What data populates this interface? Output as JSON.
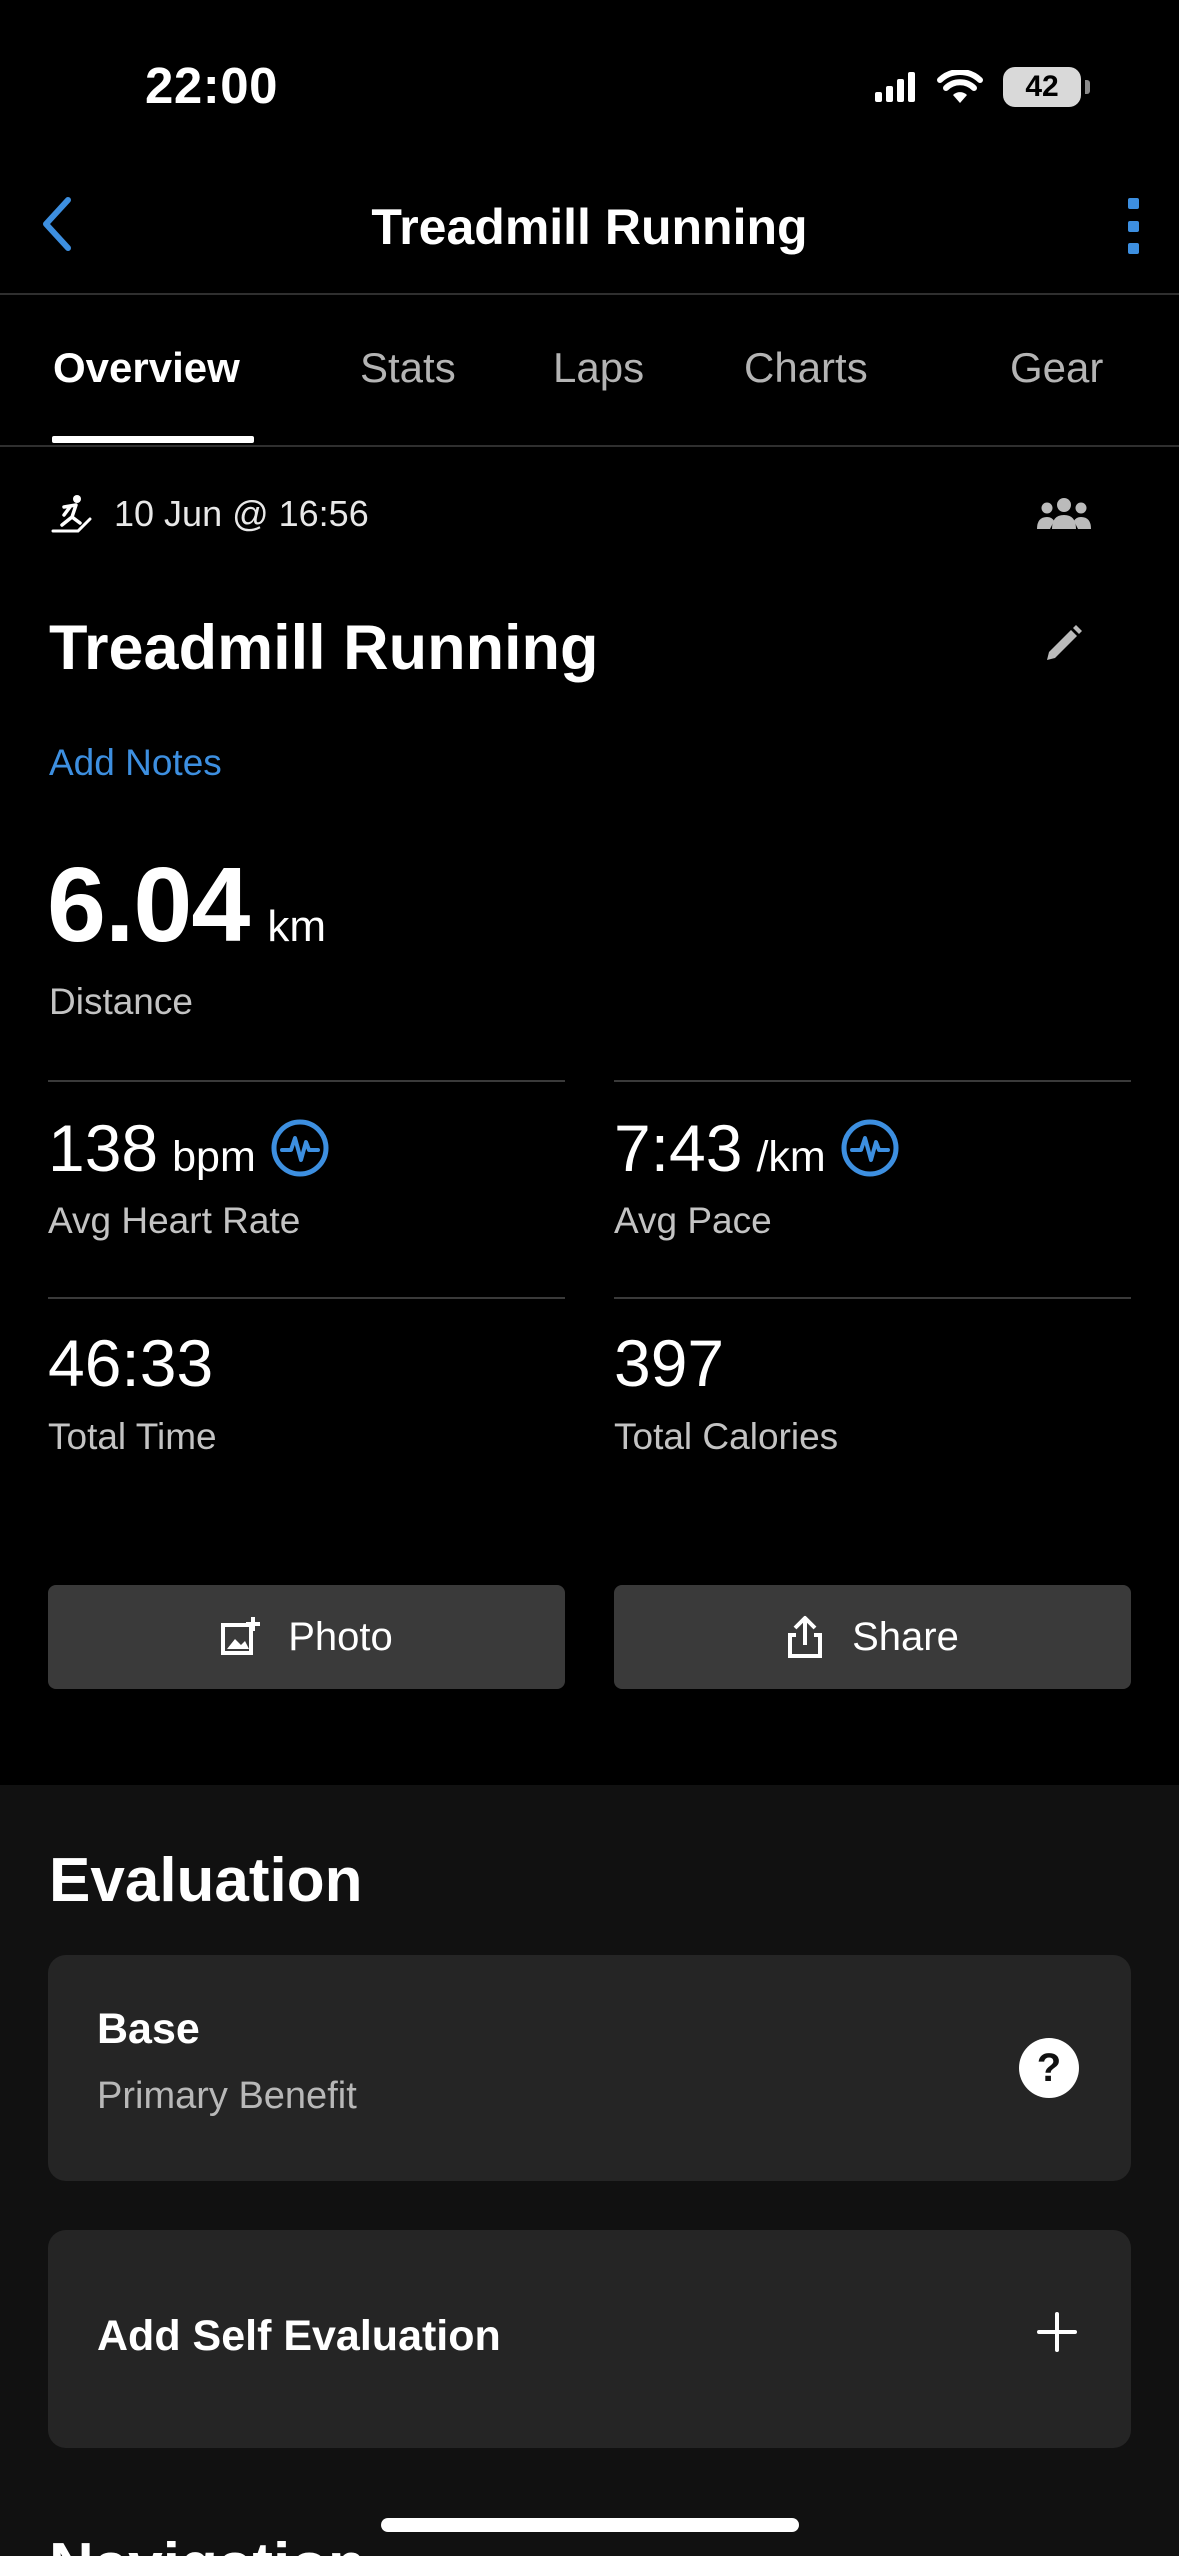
{
  "status_bar": {
    "time": "22:00",
    "battery": "42"
  },
  "nav": {
    "title": "Treadmill Running"
  },
  "tabs": [
    {
      "label": "Overview"
    },
    {
      "label": "Stats"
    },
    {
      "label": "Laps"
    },
    {
      "label": "Charts"
    },
    {
      "label": "Gear"
    }
  ],
  "overview": {
    "date": "10 Jun @ 16:56",
    "title": "Treadmill Running",
    "add_notes": "Add Notes",
    "distance": {
      "value": "6.04",
      "unit": "km",
      "label": "Distance"
    },
    "stats": {
      "heart_rate": {
        "value": "138",
        "unit": "bpm",
        "label": "Avg Heart Rate"
      },
      "pace": {
        "value": "7:43",
        "unit": "/km",
        "label": "Avg Pace"
      },
      "time": {
        "value": "46:33",
        "label": "Total Time"
      },
      "calories": {
        "value": "397",
        "label": "Total Calories"
      }
    },
    "buttons": {
      "photo": "Photo",
      "share": "Share"
    }
  },
  "evaluation": {
    "heading": "Evaluation",
    "primary": {
      "title": "Base",
      "subtitle": "Primary Benefit"
    },
    "self_eval": "Add Self Evaluation",
    "next_heading_partial": "Navigation"
  },
  "colors": {
    "accent": "#3d8fe0",
    "background": "#000000",
    "card": "#252525"
  }
}
